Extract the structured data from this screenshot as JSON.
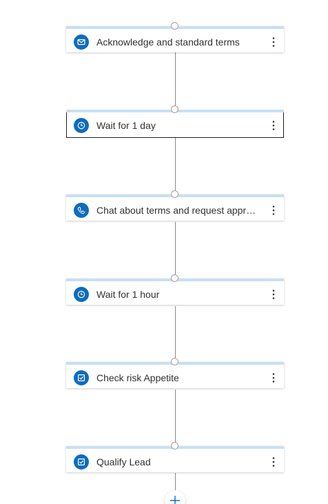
{
  "colors": {
    "accent": "#0f6cbd",
    "card_topbar": "#c7e0f4",
    "connector": "#8a8886",
    "text": "#323130"
  },
  "steps": [
    {
      "label": "Acknowledge and standard terms",
      "icon": "mail-icon",
      "selected": false
    },
    {
      "label": "Wait for 1 day",
      "icon": "clock-icon",
      "selected": true
    },
    {
      "label": "Chat about terms and request approval",
      "icon": "phone-icon",
      "selected": false
    },
    {
      "label": "Wait for 1 hour",
      "icon": "clock-icon",
      "selected": false
    },
    {
      "label": "Check risk Appetite",
      "icon": "task-checkbox-icon",
      "selected": false
    },
    {
      "label": "Qualify Lead",
      "icon": "task-checkbox-icon",
      "selected": false
    }
  ],
  "more_options_icon": "more-vertical-icon",
  "add_step_icon": "plus-icon"
}
